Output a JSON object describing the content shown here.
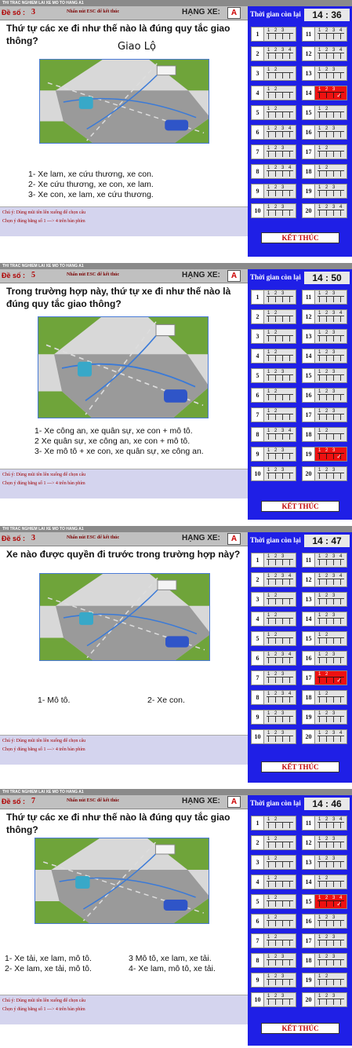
{
  "title_bar": "THI TRAC NGHIEM LAI XE MO TO HANG A1",
  "de_so_label": "Đề số :",
  "esc_hint": "Nhấn nút ESC để kết thúc",
  "hang_xe_label": "HẠNG XE:",
  "hang_xe_value": "A",
  "time_label": "Thời gian còn lại",
  "finish_label": "KẾT THÚC",
  "note_line1": "Chú ý: Dùng mũi tên lên xuống để chọn câu",
  "note_line2": "Chọn ý đúng bằng số 1 ---> 4 trên bàn phím",
  "icon_names": [
    "pen-annotation-icon",
    "checkmark-icon"
  ],
  "colors": {
    "sidebar": "#1f1fe6",
    "highlight": "#ee1111",
    "header_gray": "#c0c0c0"
  },
  "panels": [
    {
      "de_so": "3",
      "time": "14 : 36",
      "question": "Thứ tự các xe đi như thế nào là đúng quy tắc giao thông?",
      "handwriting": "Giao Lộ",
      "answers": [
        "1- Xe lam, xe cứu thương, xe con.",
        "2- Xe cứu thương, xe con, xe lam.",
        "3- Xe con, xe lam, xe cứu thương."
      ],
      "cells": [
        {
          "n": "1",
          "o": "1 2 3"
        },
        {
          "n": "2",
          "o": "1 2 3 4"
        },
        {
          "n": "3",
          "o": "1 2"
        },
        {
          "n": "4",
          "o": "1 2"
        },
        {
          "n": "5",
          "o": "1 2"
        },
        {
          "n": "6",
          "o": "1 2 3 4"
        },
        {
          "n": "7",
          "o": "1 2 3"
        },
        {
          "n": "8",
          "o": "1 2 3 4"
        },
        {
          "n": "9",
          "o": "1 2 3"
        },
        {
          "n": "10",
          "o": "1 2 3"
        },
        {
          "n": "11",
          "o": "1 2 3 4"
        },
        {
          "n": "12",
          "o": "1 2 3 4"
        },
        {
          "n": "13",
          "o": "1 2 3"
        },
        {
          "n": "14",
          "o": "1 2 3",
          "hl": true
        },
        {
          "n": "15",
          "o": "1 2"
        },
        {
          "n": "16",
          "o": "1 2 3"
        },
        {
          "n": "17",
          "o": "1 2"
        },
        {
          "n": "18",
          "o": "1 2"
        },
        {
          "n": "19",
          "o": "1 2 3"
        },
        {
          "n": "20",
          "o": "1 2 3 4"
        }
      ]
    },
    {
      "de_so": "5",
      "time": "14 : 50",
      "question": "Trong trường hợp này, thứ tự xe đi như thế nào là đúng quy tắc giao thông?",
      "handwriting": "",
      "answers": [
        "1- Xe công an, xe quân sự, xe con + mô tô.",
        "2 Xe quân sự, xe công an, xe con + mô tô.",
        "3- Xe mô tô +  xe con, xe quân sự, xe công an."
      ],
      "cells": [
        {
          "n": "1",
          "o": "1 2 3"
        },
        {
          "n": "2",
          "o": "1 2"
        },
        {
          "n": "3",
          "o": "1 2"
        },
        {
          "n": "4",
          "o": "1 2"
        },
        {
          "n": "5",
          "o": "1 2 3"
        },
        {
          "n": "6",
          "o": "1 2"
        },
        {
          "n": "7",
          "o": "1 2"
        },
        {
          "n": "8",
          "o": "1 2 3 4"
        },
        {
          "n": "9",
          "o": "1 2 3"
        },
        {
          "n": "10",
          "o": "1 2 3"
        },
        {
          "n": "11",
          "o": "1 2 3"
        },
        {
          "n": "12",
          "o": "1 2 3 4"
        },
        {
          "n": "13",
          "o": "1 2 3"
        },
        {
          "n": "14",
          "o": "1 2 3"
        },
        {
          "n": "15",
          "o": "1 2 3"
        },
        {
          "n": "16",
          "o": "1 2 3"
        },
        {
          "n": "17",
          "o": "1 2 3"
        },
        {
          "n": "18",
          "o": "1 2"
        },
        {
          "n": "19",
          "o": "1 2 3",
          "hl": true
        },
        {
          "n": "20",
          "o": "1 2 3"
        }
      ]
    },
    {
      "de_so": "3",
      "time": "14 : 47",
      "question": "Xe nào được quyền đi trước trong trường hợp này?",
      "handwriting": "",
      "answers": [
        "1- Mô tô.",
        "2- Xe con."
      ],
      "cells": [
        {
          "n": "1",
          "o": "1 2 3"
        },
        {
          "n": "2",
          "o": "1 2 3 4"
        },
        {
          "n": "3",
          "o": "1 2"
        },
        {
          "n": "4",
          "o": "1 2"
        },
        {
          "n": "5",
          "o": "1 2"
        },
        {
          "n": "6",
          "o": "1 2 3 4"
        },
        {
          "n": "7",
          "o": "1 2 3"
        },
        {
          "n": "8",
          "o": "1 2 3 4"
        },
        {
          "n": "9",
          "o": "1 2 3"
        },
        {
          "n": "10",
          "o": "1 2 3"
        },
        {
          "n": "11",
          "o": "1 2 3 4"
        },
        {
          "n": "12",
          "o": "1 2 3 4"
        },
        {
          "n": "13",
          "o": "1 2 3"
        },
        {
          "n": "14",
          "o": "1 2 3"
        },
        {
          "n": "15",
          "o": "1 2"
        },
        {
          "n": "16",
          "o": "1 2 3"
        },
        {
          "n": "17",
          "o": "1 2",
          "hl": true
        },
        {
          "n": "18",
          "o": "1 2"
        },
        {
          "n": "19",
          "o": "1 2 3"
        },
        {
          "n": "20",
          "o": "1 2 3 4"
        }
      ]
    },
    {
      "de_so": "7",
      "time": "14 : 46",
      "question": "Thứ tự các xe đi như thế nào là đúng quy tắc giao thông?",
      "handwriting": "",
      "answers": [
        "1- Xe tải, xe lam, mô tô.",
        "3 Mô tô, xe lam, xe tải.",
        "2- Xe lam, xe tải, mô tô.",
        "4- Xe lam, mô tô, xe tải."
      ],
      "cells": [
        {
          "n": "1",
          "o": "1 2"
        },
        {
          "n": "2",
          "o": "1 2"
        },
        {
          "n": "3",
          "o": "1 2"
        },
        {
          "n": "4",
          "o": "1 2"
        },
        {
          "n": "5",
          "o": "1 2"
        },
        {
          "n": "6",
          "o": "1 2"
        },
        {
          "n": "7",
          "o": "1 2"
        },
        {
          "n": "8",
          "o": "1 2 3"
        },
        {
          "n": "9",
          "o": "1 2 3"
        },
        {
          "n": "10",
          "o": "1 2 3"
        },
        {
          "n": "11",
          "o": "1 2 3 4"
        },
        {
          "n": "12",
          "o": "1 2 3"
        },
        {
          "n": "13",
          "o": "1 2 3"
        },
        {
          "n": "14",
          "o": "1 2"
        },
        {
          "n": "15",
          "o": "1 2 3 4",
          "hl": true
        },
        {
          "n": "16",
          "o": "1 2 3"
        },
        {
          "n": "17",
          "o": "1 2 3"
        },
        {
          "n": "18",
          "o": "1 2 3"
        },
        {
          "n": "19",
          "o": "1 2"
        },
        {
          "n": "20",
          "o": "1 2 3"
        }
      ]
    }
  ]
}
